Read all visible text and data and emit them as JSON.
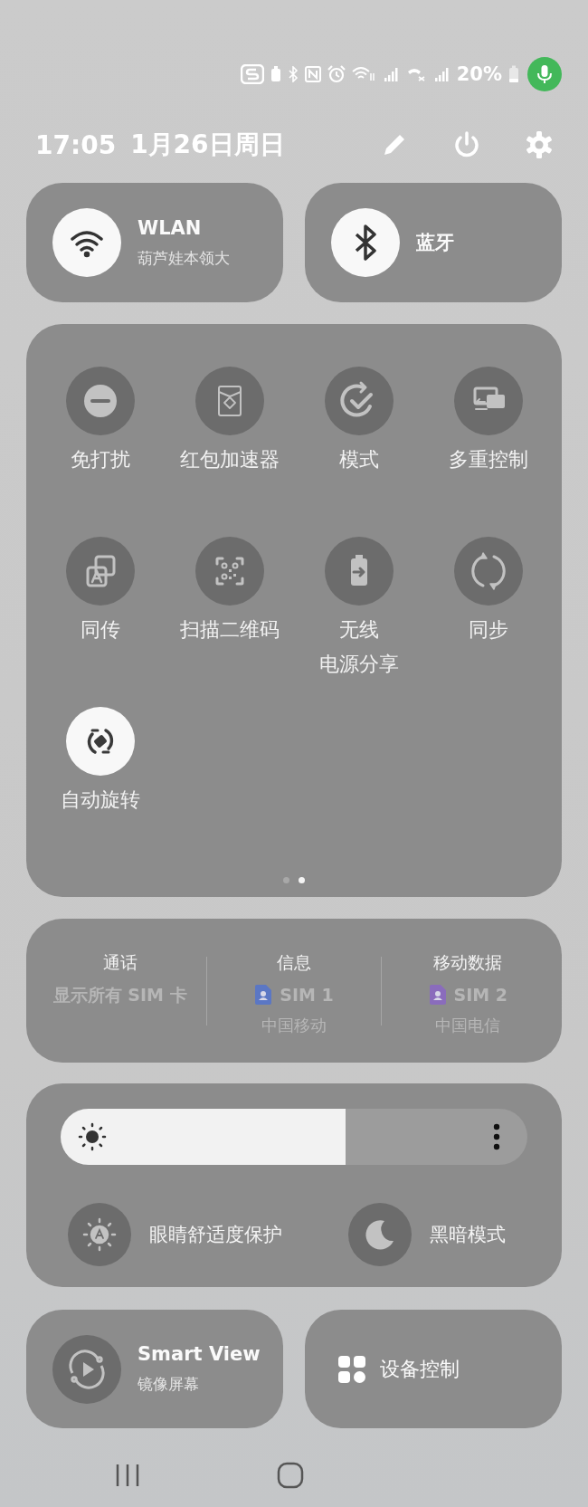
{
  "status_bar": {
    "battery": "20%"
  },
  "header": {
    "time": "17:05",
    "date": "1月26日周日"
  },
  "connectivity_tiles": [
    {
      "kind": "wifi",
      "title": "WLAN",
      "subtitle": "葫芦娃本领大",
      "on": true
    },
    {
      "kind": "bluetooth",
      "title": "蓝牙",
      "on": true
    }
  ],
  "quick_toggles": [
    {
      "kind": "dnd",
      "label": "免打扰",
      "on": false
    },
    {
      "kind": "red-packet",
      "label": "红包加速器",
      "on": false
    },
    {
      "kind": "modes",
      "label": "模式",
      "on": false
    },
    {
      "kind": "multi-control",
      "label": "多重控制",
      "on": false
    },
    {
      "kind": "transfer",
      "label": "同传",
      "on": false
    },
    {
      "kind": "qr-scan",
      "label": "扫描二维码",
      "on": false
    },
    {
      "kind": "power-share",
      "label": "无线",
      "label_line_2": "电源分享",
      "on": false
    },
    {
      "kind": "sync",
      "label": "同步",
      "on": false
    },
    {
      "kind": "rotate",
      "label": "自动旋转",
      "on": true
    }
  ],
  "pages": [
    {
      "selected": false
    },
    {
      "selected": true
    }
  ],
  "sim_settings": [
    {
      "title": "通话",
      "value": "显示所有 SIM 卡"
    },
    {
      "title": "信息",
      "value": "SIM 1",
      "carrier": "中国移动",
      "color": "#5b77c4"
    },
    {
      "title": "移动数据",
      "value": "SIM 2",
      "carrier": "中国电信",
      "color": "#8a6cbc"
    }
  ],
  "brightness": {
    "level": 0.61
  },
  "display_toggles": [
    {
      "kind": "eye-comfort",
      "label": "眼睛舒适度保护",
      "on": false
    },
    {
      "kind": "dark-mode",
      "label": "黑暗模式",
      "on": false
    }
  ],
  "bottom_tiles": [
    {
      "kind": "smart-view",
      "title": "Smart View",
      "subtitle": "镜像屏幕"
    },
    {
      "kind": "device-control",
      "title": "设备控制"
    }
  ]
}
